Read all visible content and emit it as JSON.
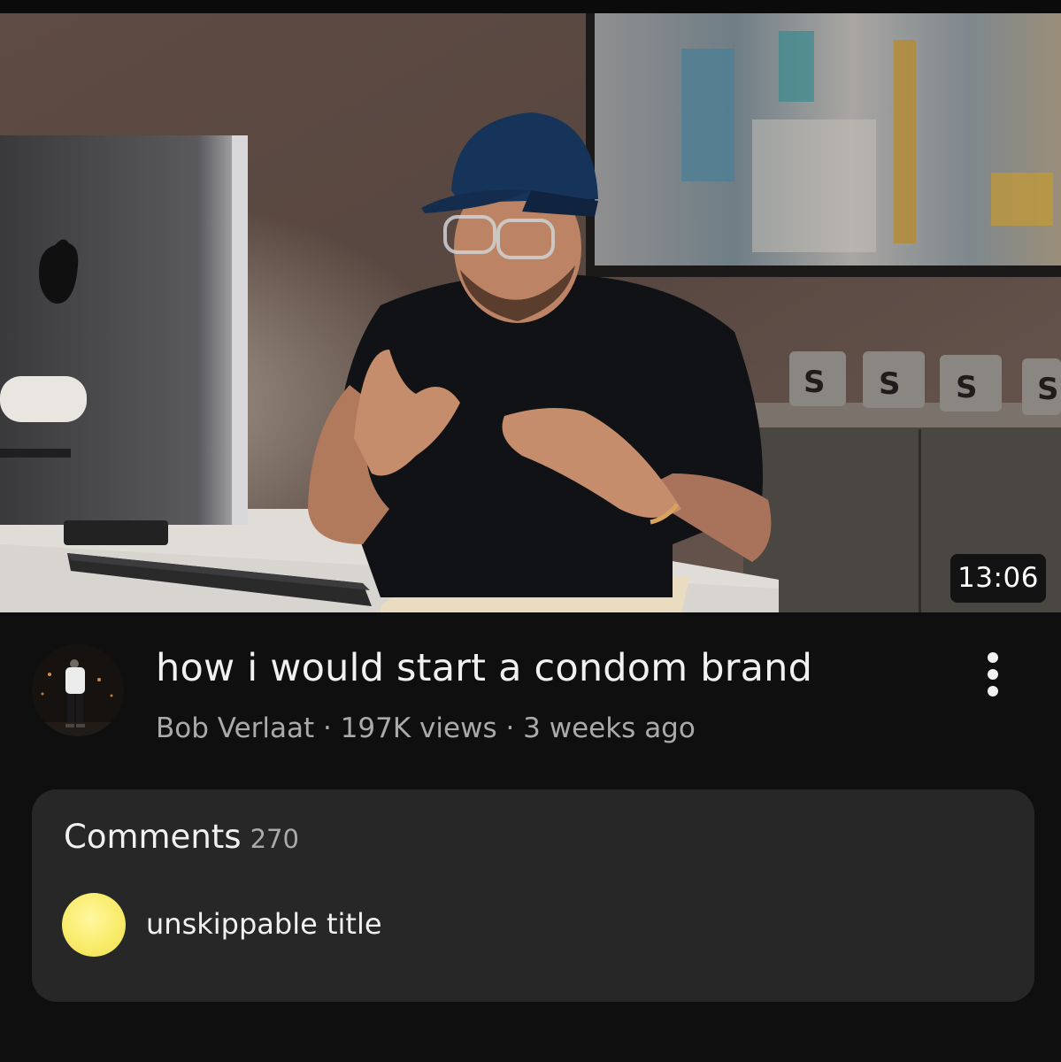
{
  "video": {
    "duration": "13:06",
    "title": "how i would start a condom brand",
    "meta": "Bob Verlaat · 197K views · 3 weeks ago"
  },
  "comments": {
    "title": "Comments",
    "count": "270",
    "top_comment": "unskippable title"
  },
  "icons": {
    "more": "more-vert-icon"
  },
  "colors": {
    "background": "#0f0f0f",
    "panel": "#272727",
    "primary_text": "#f1f1f1",
    "secondary_text": "#aaaaaa",
    "commenter_avatar": "#f9ec6b"
  }
}
